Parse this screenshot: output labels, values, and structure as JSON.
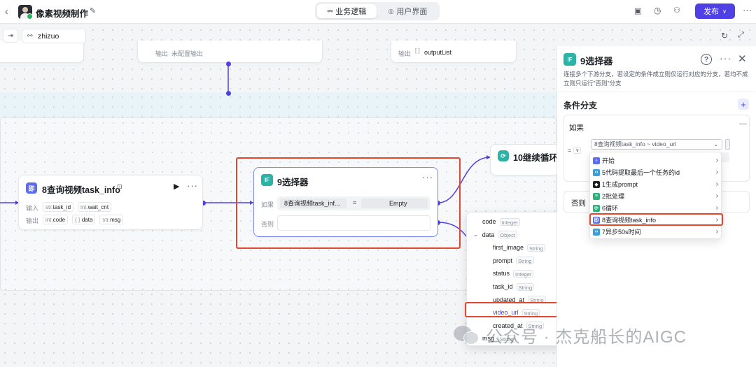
{
  "app": {
    "title": "像素视频制作",
    "tabs": [
      {
        "label": "业务逻辑",
        "active": true
      },
      {
        "label": "用户界面",
        "active": false
      }
    ],
    "publish_label": "发布"
  },
  "subbar": {
    "workflow_name": "zhizuo"
  },
  "canvas": {
    "top_node_left": {
      "output_label": "输出",
      "output_value": "未配置输出"
    },
    "top_node_right": {
      "output_label": "输出",
      "output_type": "[ ]",
      "output_value": "outputList"
    },
    "task_node": {
      "title": "8查询视频task_info",
      "input_label": "输入",
      "inputs": [
        {
          "type": "str.",
          "name": "task_id"
        },
        {
          "type": "int.",
          "name": "wait_cnt"
        }
      ],
      "output_label": "输出",
      "outputs": [
        {
          "type": "int.",
          "name": "code"
        },
        {
          "type": "{ }",
          "name": "data"
        },
        {
          "type": "str.",
          "name": "msg"
        }
      ]
    },
    "selector_node": {
      "title": "9选择器",
      "if_label": "如果",
      "condition_left": "8查询视频task_inf...",
      "condition_op": "=",
      "condition_right": "Empty",
      "else_label": "否则"
    },
    "loop_node": {
      "title": "10继续循环"
    }
  },
  "panel": {
    "title": "9选择器",
    "description": "连接多个下游分支，若设定的条件成立则仅运行对应的分支，若均不成立则只运行\"否则\"分支",
    "section_title": "条件分支",
    "if_label": "如果",
    "op_symbol": "=",
    "variable_value": "8查询视频task_info ~ video_url",
    "else_label": "否则"
  },
  "dropdown": {
    "items": [
      {
        "label": "开始",
        "color": "#5b6cf0",
        "icon": "start-icon"
      },
      {
        "label": "5代码提取最后一个任务的id",
        "color": "#3a9fd6",
        "icon": "code-icon"
      },
      {
        "label": "1生成prompt",
        "color": "#1c1f23",
        "icon": "llm-icon"
      },
      {
        "label": "2批处理",
        "color": "#2bb37c",
        "icon": "batch-icon"
      },
      {
        "label": "6循环",
        "color": "#2bb37c",
        "icon": "loop-icon"
      },
      {
        "label": "8查询视频task_info",
        "color": "#5b6cf0",
        "icon": "plugin-icon"
      },
      {
        "label": "7异步50s时间",
        "color": "#3a9fd6",
        "icon": "code-icon"
      }
    ]
  },
  "tree": {
    "rows": [
      {
        "name": "code",
        "type": "Integer",
        "level": 0
      },
      {
        "name": "data",
        "type": "Object",
        "level": 0,
        "expanded": true
      },
      {
        "name": "first_image",
        "type": "String",
        "level": 1
      },
      {
        "name": "prompt",
        "type": "String",
        "level": 1
      },
      {
        "name": "status",
        "type": "Integer",
        "level": 1
      },
      {
        "name": "task_id",
        "type": "String",
        "level": 1
      },
      {
        "name": "updated_at",
        "type": "String",
        "level": 1
      },
      {
        "name": "video_url",
        "type": "String",
        "level": 1,
        "selected": true
      },
      {
        "name": "created_at",
        "type": "String",
        "level": 1
      },
      {
        "name": "msg",
        "type": "String",
        "level": 0
      }
    ]
  },
  "watermark": "公众号 · 杰克船长的AIGC",
  "colors": {
    "accent": "#4e40e5",
    "highlight": "#e5462f",
    "if_teal": "#2bb3a6"
  }
}
